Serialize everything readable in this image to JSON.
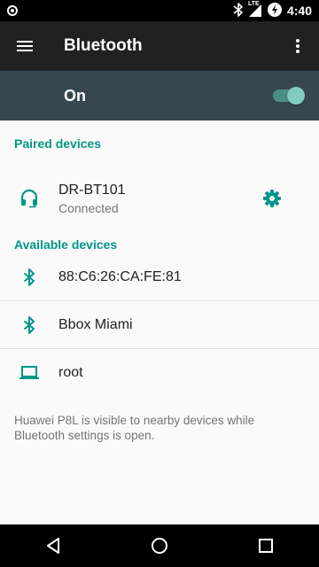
{
  "status_bar": {
    "time": "4:40",
    "network_label": "LTE",
    "icons": [
      "notification-dot-icon",
      "bluetooth-icon",
      "signal-icon",
      "battery-charging-icon"
    ]
  },
  "app_bar": {
    "title": "Bluetooth",
    "menu_icon": "hamburger-menu-icon",
    "overflow_icon": "more-vert-icon"
  },
  "master_switch": {
    "label": "On",
    "state": true
  },
  "paired": {
    "header": "Paired devices",
    "devices": [
      {
        "name": "DR-BT101",
        "status": "Connected",
        "icon": "headset-icon"
      }
    ]
  },
  "available": {
    "header": "Available devices",
    "devices": [
      {
        "name": "88:C6:26:CA:FE:81",
        "icon": "bluetooth-icon"
      },
      {
        "name": "Bbox Miami",
        "icon": "bluetooth-icon"
      },
      {
        "name": "root",
        "icon": "laptop-icon"
      }
    ]
  },
  "footer": "Huawei P8L is visible to nearby devices while Bluetooth settings is open.",
  "colors": {
    "accent": "#009688",
    "app_bar": "#212121",
    "switch_bar": "#37474f"
  }
}
